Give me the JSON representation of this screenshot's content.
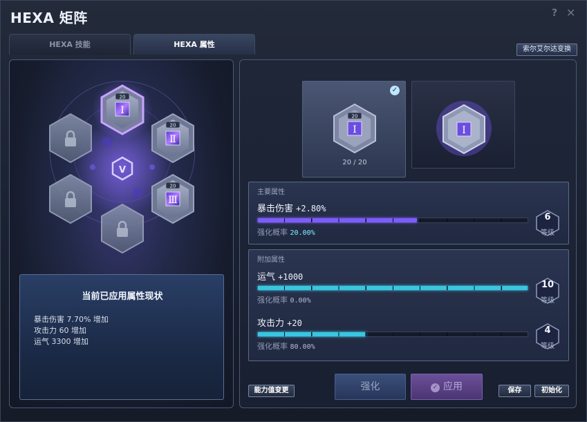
{
  "window": {
    "title": "HEXA 矩阵"
  },
  "tabs": [
    {
      "label": "HEXA 技能",
      "active": false
    },
    {
      "label": "HEXA 属性",
      "active": true
    }
  ],
  "solerda_button": "索尔艾尔达变换",
  "hex_matrix": {
    "center_symbol": "V",
    "slots": [
      {
        "numeral": "Ⅰ",
        "level": "20",
        "state": "selected"
      },
      {
        "numeral": "Ⅱ",
        "level": "20",
        "state": "active"
      },
      {
        "numeral": "Ⅲ",
        "level": "20",
        "state": "active"
      },
      {
        "state": "locked"
      },
      {
        "state": "locked"
      },
      {
        "state": "locked"
      }
    ]
  },
  "status_box": {
    "title": "当前已应用属性现状",
    "lines": [
      "暴击伤害 7.70% 增加",
      "攻击力 60 增加",
      "运气 3300 增加"
    ]
  },
  "cards": [
    {
      "numeral": "Ⅰ",
      "level": "20",
      "progress_text": "20 / 20",
      "selected": true
    },
    {
      "numeral": "Ⅰ",
      "selected": false
    }
  ],
  "main_attr": {
    "section_label": "主要属性",
    "name": "暴击伤害",
    "value": "+2.80%",
    "prob_label": "强化概率",
    "prob_value": "20.00%",
    "fill_fraction": 0.59,
    "grade_num": "6",
    "grade_label": "等级",
    "bar_color": "#7d5cff"
  },
  "extra_attr": {
    "section_label": "附加属性",
    "items": [
      {
        "name": "运气",
        "value": "+1000",
        "prob_label": "强化概率",
        "prob_value": "0.00%",
        "fill_fraction": 1.0,
        "grade_num": "10",
        "grade_label": "等级",
        "bar_color": "#38c6e0"
      },
      {
        "name": "攻击力",
        "value": "+20",
        "prob_label": "强化概率",
        "prob_value": "80.00%",
        "fill_fraction": 0.4,
        "grade_num": "4",
        "grade_label": "等级",
        "bar_color": "#38c6e0"
      }
    ]
  },
  "buttons": {
    "stat_change": "能力值变更",
    "enhance": "强化",
    "apply": "应用",
    "save": "保存",
    "initialize": "初始化"
  },
  "colors": {
    "accent_purple": "#8a6cff",
    "accent_cyan": "#38c6e0",
    "highlight_text": "#7ff0ff"
  }
}
